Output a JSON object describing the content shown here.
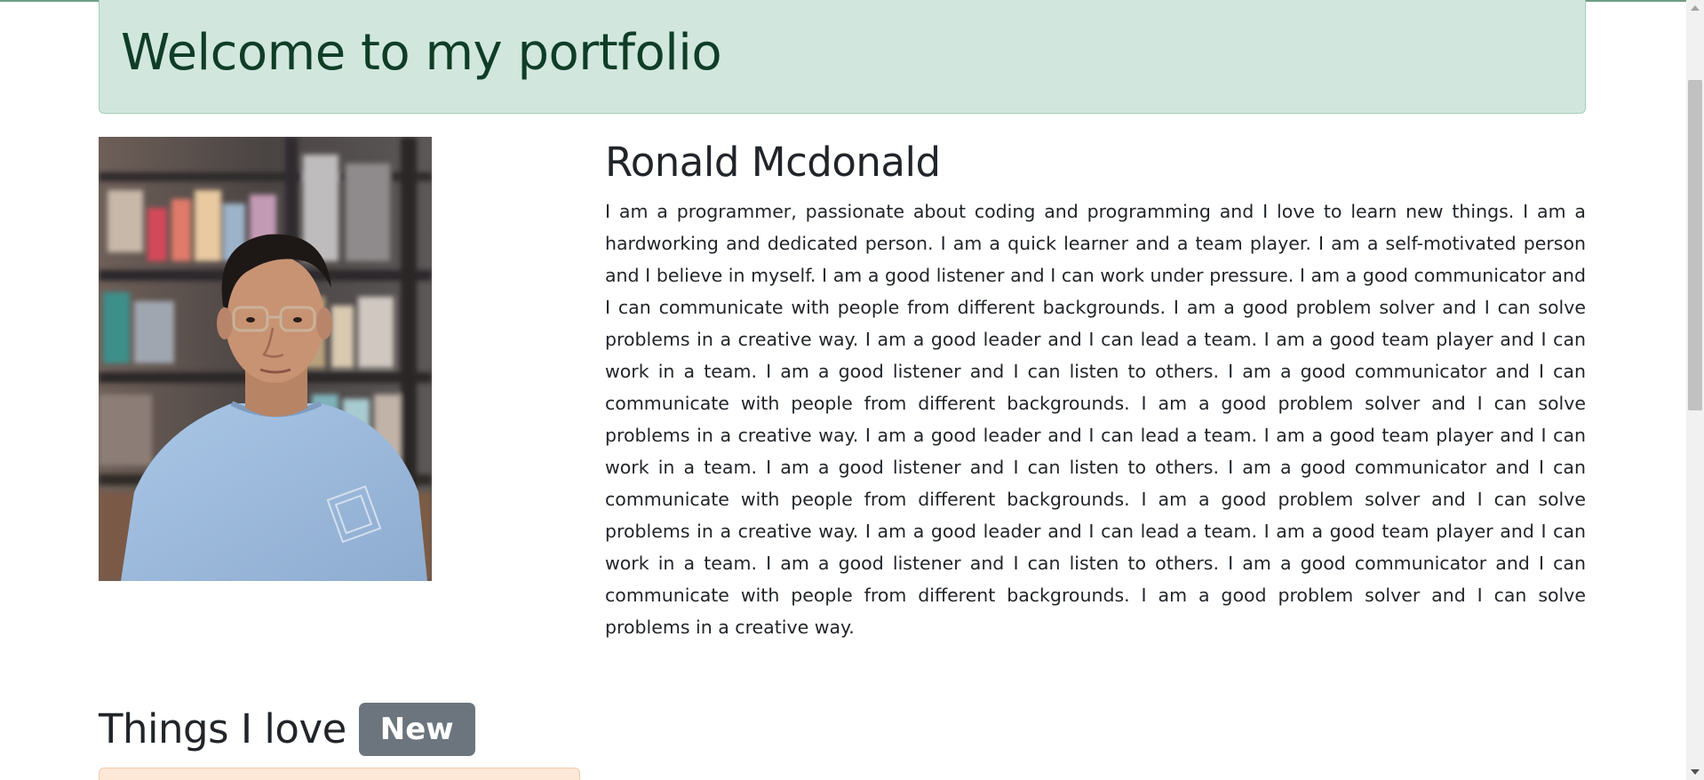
{
  "header": {
    "title": "Welcome to my portfolio"
  },
  "profile": {
    "photo_icon": "portrait-photo",
    "name": "Ronald Mcdonald",
    "bio": "I am a programmer, passionate about coding and programming and I love to learn new things. I am a hardworking and dedicated person. I am a quick learner and a team player. I am a self-motivated person and I believe in myself. I am a good listener and I can work under pressure. I am a good communicator and I can communicate with people from different backgrounds. I am a good problem solver and I can solve problems in a creative way. I am a good leader and I can lead a team. I am a good team player and I can work in a team. I am a good listener and I can listen to others. I am a good communicator and I can communicate with people from different backgrounds. I am a good problem solver and I can solve problems in a creative way. I am a good leader and I can lead a team. I am a good team player and I can work in a team. I am a good listener and I can listen to others. I am a good communicator and I can communicate with people from different backgrounds. I am a good problem solver and I can solve problems in a creative way. I am a good leader and I can lead a team. I am a good team player and I can work in a team. I am a good listener and I can listen to others. I am a good communicator and I can communicate with people from different backgrounds. I am a good problem solver and I can solve problems in a creative way."
  },
  "things": {
    "heading": "Things I love",
    "badge": "New"
  },
  "colors": {
    "alert_background": "#d1e7dd",
    "alert_text": "#0f3d28",
    "badge_background": "#6c757d",
    "card_background": "#fde8d7"
  }
}
